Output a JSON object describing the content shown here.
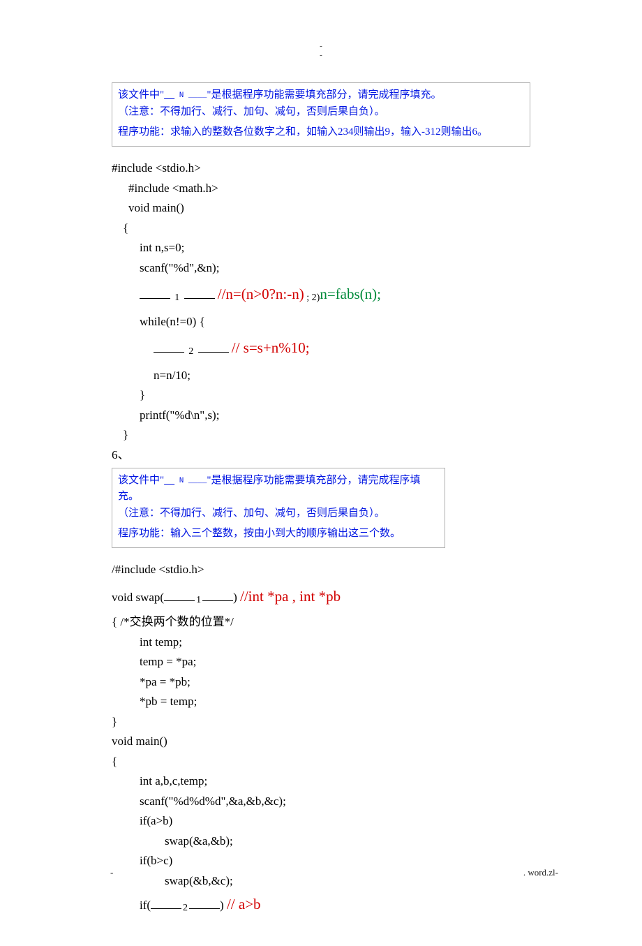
{
  "top_dash": "-",
  "box1": {
    "l1a": "该文件中\"",
    "l1b": " N ____",
    "l1c": "\"是根据程序功能需要填充部分，请完成程序填充。",
    "l2": "（注意：不得加行、减行、加句、减句，否则后果自负）。",
    "l3": "程序功能：求输入的整数各位数字之和，如输入234则输出9，输入-312则输出6。"
  },
  "code1": {
    "c01": "#include <stdio.h>",
    "c02": "#include <math.h>",
    "c03": "void main()",
    "c04": "{",
    "c05": "int n,s=0;",
    "c06": "scanf(\"%d\",&n);",
    "b1num": "1",
    "ans1a": "//n=(n>0?n:-n)",
    "ans1mid": " ; 2)",
    "ans1b": "n=fabs(n);",
    "c08": "while(n!=0) {",
    "b2num": "2",
    "ans2": "// s=s+n%10;",
    "c10": "n=n/10;",
    "c11": "}",
    "c12": "printf(\"%d\\n\",s);",
    "c13": "}"
  },
  "sep": "6、",
  "box2": {
    "l1a": "该文件中\"",
    "l1b": " N ____",
    "l1c": "\"是根据程序功能需要填充部分，请完成程序填充。",
    "l2": "（注意：不得加行、减行、加句、减句，否则后果自负）。",
    "l3": "程序功能：输入三个整数，按由小到大的顺序输出这三个数。"
  },
  "code2": {
    "c01": "/#include <stdio.h>",
    "c02a": "void swap(",
    "b1num": "1",
    "c02b": ")",
    "ans1": "//int *pa , int *pb",
    "c03": "{ /*交换两个数的位置*/",
    "c04": "int temp;",
    "c05": "temp = *pa;",
    "c06": "*pa = *pb;",
    "c07": "*pb = temp;",
    "c08": "}",
    "c09": "void main()",
    "c10": "{",
    "c11": "int a,b,c,temp;",
    "c12": "scanf(\"%d%d%d\",&a,&b,&c);",
    "c13": "if(a>b)",
    "c14": "swap(&a,&b);",
    "c15": "if(b>c)",
    "c16": "swap(&b,&c);",
    "c17a": "if(",
    "b2num": "2",
    "c17b": ")",
    "ans2": "// a>b"
  },
  "footer": {
    "left": "-",
    "right": ". word.zl-"
  }
}
